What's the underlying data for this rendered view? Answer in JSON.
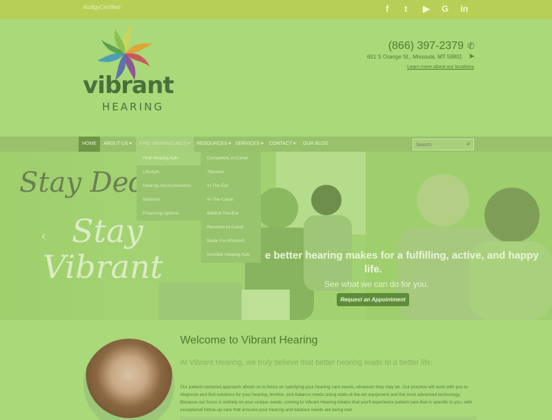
{
  "topbar": {
    "certified_label": "AudigyCertified",
    "social_icons": [
      "facebook-icon",
      "twitter-icon",
      "youtube-icon",
      "google-icon",
      "linkedin-icon"
    ],
    "social_glyphs": [
      "f",
      "t",
      "▶",
      "G",
      "in"
    ]
  },
  "header": {
    "logo_word": "vibrant",
    "logo_sub": "HEARING",
    "phone": "(866) 397-2379",
    "address": "601 S Orange St., Missoula, MT 59801",
    "locations_link": "Learn more about our locations"
  },
  "nav": {
    "items": [
      "HOME",
      "ABOUT US ▾",
      "FIND HEARING AIDS ▾",
      "RESOURCES ▾",
      "SERVICES ▾",
      "CONTACT ▾",
      "OUR BLOG"
    ],
    "search_placeholder": "Search"
  },
  "dropdown_find": [
    "Find Hearing Aids",
    "Lifestyle",
    "Hearing Aid Accessories",
    "Batteries",
    "Financing Options"
  ],
  "dropdown_styles": [
    "Completely-in-Canal",
    "Titanium",
    "In-The-Ear",
    "In-The-Canal",
    "Behind-The-Ear",
    "Receiver-In-Canal",
    "Made For iPhone®",
    "Invisible Hearing Aids"
  ],
  "hero": {
    "script_top": "Stay Ded",
    "script_stay": "Stay",
    "script_vibrant": "Vibrant",
    "headline_1": "e better hearing makes for a fulfilling, active, and happy",
    "headline_2": "life.",
    "subline": "See what we can do for you.",
    "cta_label": "Request an Appointment"
  },
  "welcome": {
    "title": "Welcome to Vibrant Hearing",
    "subtitle": "At Vibrant Hearing, we truly believe that better hearing leads to a better life.",
    "body": "Our patient-centered approach allows us to focus on satisfying your hearing care needs, whatever they may be. Our practice will work with you to diagnose and find solutions for your hearing, tinnitus, and balance needs using state-of-the-art equipment and the most advanced technology. Because our focus is entirely on your unique needs, coming to Vibrant Hearing means that you'll experience patient care that is specific to you, with exceptional follow-up care that ensures your hearing and balance needs are being met."
  },
  "colors": {
    "topbar": "#b7cf57",
    "background": "#a9d979",
    "nav": "#97c26b",
    "nav_active": "#6f9547",
    "cta": "#5d8d3b",
    "title": "#4a7a2c"
  }
}
